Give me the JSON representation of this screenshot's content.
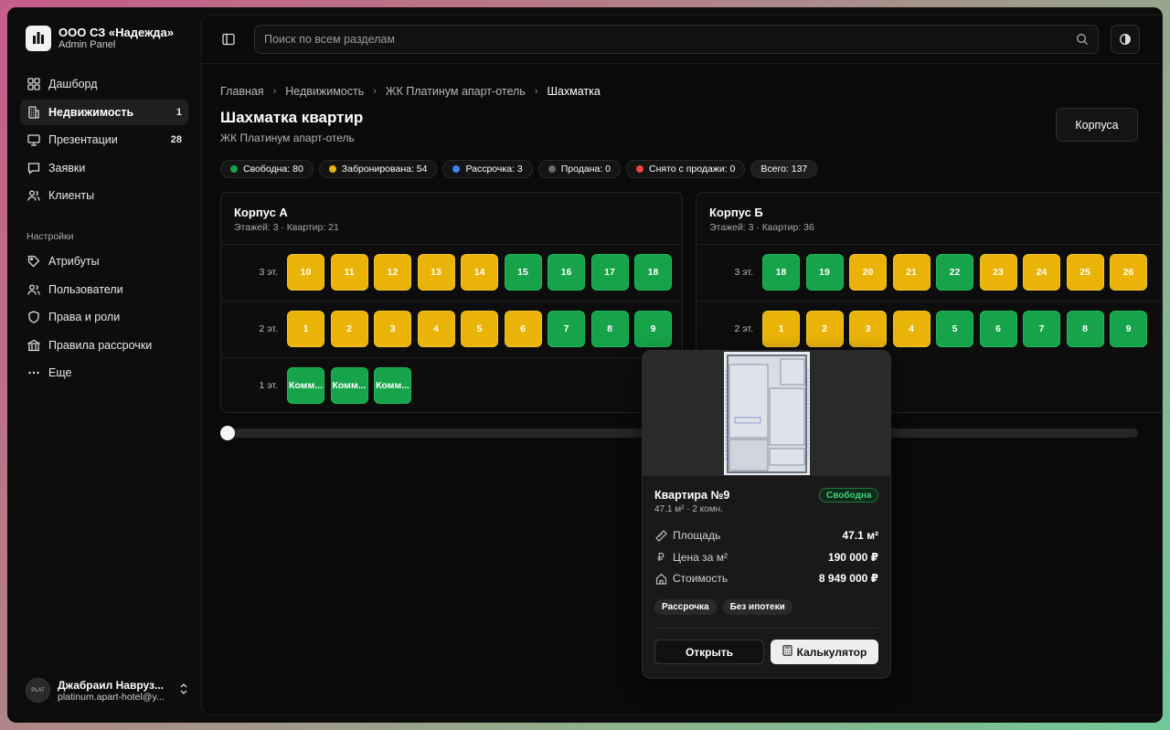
{
  "org": {
    "name": "ООО СЗ «Надежда»",
    "subtitle": "Admin Panel"
  },
  "nav": [
    {
      "label": "Дашборд",
      "icon": "dashboard-icon",
      "count": ""
    },
    {
      "label": "Недвижимость",
      "icon": "building-icon",
      "count": "1",
      "active": true
    },
    {
      "label": "Презентации",
      "icon": "presentation-icon",
      "count": "28"
    },
    {
      "label": "Заявки",
      "icon": "message-icon",
      "count": ""
    },
    {
      "label": "Клиенты",
      "icon": "users-icon",
      "count": ""
    }
  ],
  "settings_label": "Настройки",
  "settings": [
    {
      "label": "Атрибуты",
      "icon": "tag-icon"
    },
    {
      "label": "Пользователи",
      "icon": "users-icon"
    },
    {
      "label": "Права и роли",
      "icon": "shield-icon"
    },
    {
      "label": "Правила рассрочки",
      "icon": "rules-icon"
    },
    {
      "label": "Еще",
      "icon": "more-icon"
    }
  ],
  "user": {
    "name": "Джабраил Навруз...",
    "email": "platinum.apart-hotel@y..."
  },
  "search": {
    "placeholder": "Поиск по всем разделам"
  },
  "breadcrumbs": [
    "Главная",
    "Недвижимость",
    "ЖК Платинум апарт-отель",
    "Шахматка"
  ],
  "page": {
    "title": "Шахматка квартир",
    "subtitle": "ЖК Платинум апарт-отель",
    "corp_button": "Корпуса"
  },
  "legend": [
    {
      "label": "Свободна: 80",
      "color": "#16a34a"
    },
    {
      "label": "Забронирована: 54",
      "color": "#eab308"
    },
    {
      "label": "Рассрочка: 3",
      "color": "#3b82f6"
    },
    {
      "label": "Продана: 0",
      "color": "#6b6b6b"
    },
    {
      "label": "Снято с продажи: 0",
      "color": "#ef4444"
    },
    {
      "label": "Всего: 137",
      "color": ""
    }
  ],
  "buildings": [
    {
      "title": "Корпус А",
      "subtitle": "Этажей: 3 · Квартир: 21",
      "floors": [
        {
          "label": "3 эт.",
          "units": [
            {
              "n": "10",
              "s": "booked"
            },
            {
              "n": "11",
              "s": "booked"
            },
            {
              "n": "12",
              "s": "booked"
            },
            {
              "n": "13",
              "s": "booked"
            },
            {
              "n": "14",
              "s": "booked"
            },
            {
              "n": "15",
              "s": "free"
            },
            {
              "n": "16",
              "s": "free"
            },
            {
              "n": "17",
              "s": "free"
            },
            {
              "n": "18",
              "s": "free"
            }
          ]
        },
        {
          "label": "2 эт.",
          "units": [
            {
              "n": "1",
              "s": "booked"
            },
            {
              "n": "2",
              "s": "booked"
            },
            {
              "n": "3",
              "s": "booked"
            },
            {
              "n": "4",
              "s": "booked"
            },
            {
              "n": "5",
              "s": "booked"
            },
            {
              "n": "6",
              "s": "booked"
            },
            {
              "n": "7",
              "s": "free"
            },
            {
              "n": "8",
              "s": "free"
            },
            {
              "n": "9",
              "s": "free"
            }
          ]
        },
        {
          "label": "1 эт.",
          "units": [
            {
              "n": "Комм...",
              "s": "free"
            },
            {
              "n": "Комм...",
              "s": "free"
            },
            {
              "n": "Комм...",
              "s": "free"
            }
          ]
        }
      ]
    },
    {
      "title": "Корпус Б",
      "subtitle": "Этажей: 3 · Квартир: 36",
      "floors": [
        {
          "label": "3 эт.",
          "units": [
            {
              "n": "18",
              "s": "free"
            },
            {
              "n": "19",
              "s": "free"
            },
            {
              "n": "20",
              "s": "booked"
            },
            {
              "n": "21",
              "s": "booked"
            },
            {
              "n": "22",
              "s": "free"
            },
            {
              "n": "23",
              "s": "booked"
            },
            {
              "n": "24",
              "s": "booked"
            },
            {
              "n": "25",
              "s": "booked"
            },
            {
              "n": "26",
              "s": "booked"
            }
          ]
        },
        {
          "label": "2 эт.",
          "units": [
            {
              "n": "1",
              "s": "booked"
            },
            {
              "n": "2",
              "s": "booked"
            },
            {
              "n": "3",
              "s": "booked"
            },
            {
              "n": "4",
              "s": "booked"
            },
            {
              "n": "5",
              "s": "free"
            },
            {
              "n": "6",
              "s": "free"
            },
            {
              "n": "7",
              "s": "free"
            },
            {
              "n": "8",
              "s": "free"
            },
            {
              "n": "9",
              "s": "free"
            }
          ]
        }
      ]
    }
  ],
  "popup": {
    "title": "Квартира №9",
    "subtitle": "47.1 м² · 2 комн.",
    "status": "Свободна",
    "rows": [
      {
        "label": "Площадь",
        "value": "47.1 м²",
        "icon": "ruler-icon"
      },
      {
        "label": "Цена за м²",
        "value": "190 000 ₽",
        "icon": "ruble-icon"
      },
      {
        "label": "Стоимость",
        "value": "8 949 000 ₽",
        "icon": "home-icon"
      }
    ],
    "tags": [
      "Рассрочка",
      "Без ипотеки"
    ],
    "open_label": "Открыть",
    "calc_label": "Калькулятор"
  },
  "colors": {
    "free": "#16a34a",
    "booked": "#eab308",
    "accent_bg": "#0a0a0a"
  }
}
